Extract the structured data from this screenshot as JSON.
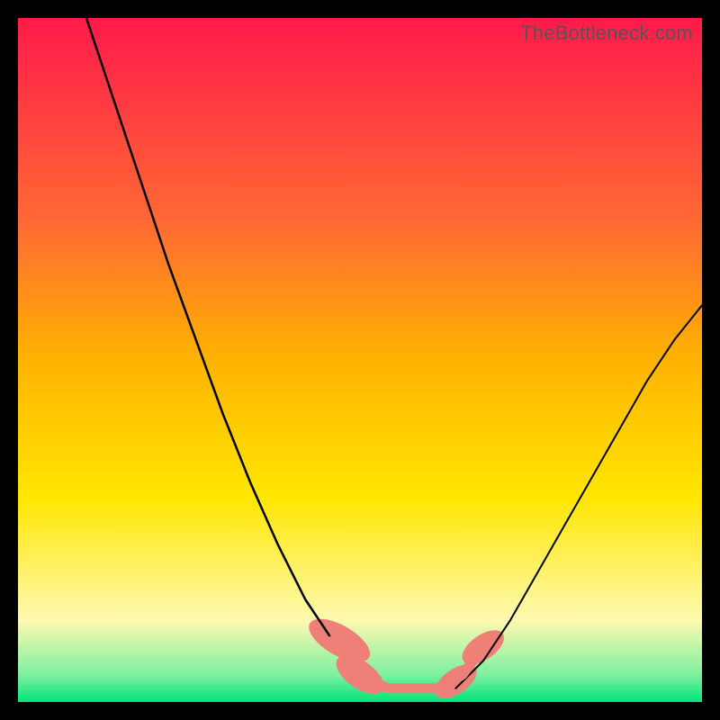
{
  "watermark": "TheBottleneck.com",
  "chart_data": {
    "type": "line",
    "title": "",
    "xlabel": "",
    "ylabel": "",
    "xlim": [
      0,
      100
    ],
    "ylim": [
      0,
      100
    ],
    "background_gradient": {
      "stops": [
        {
          "y": 100,
          "color": "#ff1a4b"
        },
        {
          "y": 70,
          "color": "#ff6a33"
        },
        {
          "y": 50,
          "color": "#ffb300"
        },
        {
          "y": 30,
          "color": "#ffe600"
        },
        {
          "y": 12,
          "color": "#fff9b0"
        },
        {
          "y": 4,
          "color": "#7ff0a0"
        },
        {
          "y": 0,
          "color": "#00e47a"
        }
      ]
    },
    "series": [
      {
        "name": "curve-left",
        "stroke": "#000000",
        "stroke_width": 2.5,
        "x": [
          10,
          14,
          18,
          22,
          26,
          30,
          34,
          38,
          42,
          46,
          50,
          54
        ],
        "y": [
          100,
          88,
          76,
          64,
          53,
          42,
          32,
          23,
          15,
          9,
          4,
          2
        ]
      },
      {
        "name": "curve-right",
        "stroke": "#000000",
        "stroke_width": 2,
        "x": [
          64,
          68,
          72,
          76,
          80,
          84,
          88,
          92,
          96,
          100
        ],
        "y": [
          2,
          6,
          12,
          19,
          26,
          33,
          40,
          47,
          53,
          58
        ]
      },
      {
        "name": "marker-band",
        "stroke": "#ef8078",
        "stroke_width": 11,
        "x": [
          46,
          50,
          54,
          58,
          62,
          65,
          68
        ],
        "y": [
          9,
          4,
          2,
          2,
          2,
          4,
          8
        ]
      }
    ],
    "markers": [
      {
        "name": "blob-left-upper",
        "cx": 47,
        "cy": 9,
        "rx": 2.2,
        "ry": 5,
        "rotate": -60,
        "fill": "#ef8078"
      },
      {
        "name": "blob-left-lower",
        "cx": 50,
        "cy": 4,
        "rx": 2.0,
        "ry": 4,
        "rotate": -55,
        "fill": "#ef8078"
      },
      {
        "name": "blob-right-lower",
        "cx": 64,
        "cy": 3,
        "rx": 1.8,
        "ry": 3.5,
        "rotate": 55,
        "fill": "#ef8078"
      },
      {
        "name": "blob-right-upper",
        "cx": 68,
        "cy": 8,
        "rx": 1.8,
        "ry": 3.5,
        "rotate": 55,
        "fill": "#ef8078"
      }
    ]
  }
}
